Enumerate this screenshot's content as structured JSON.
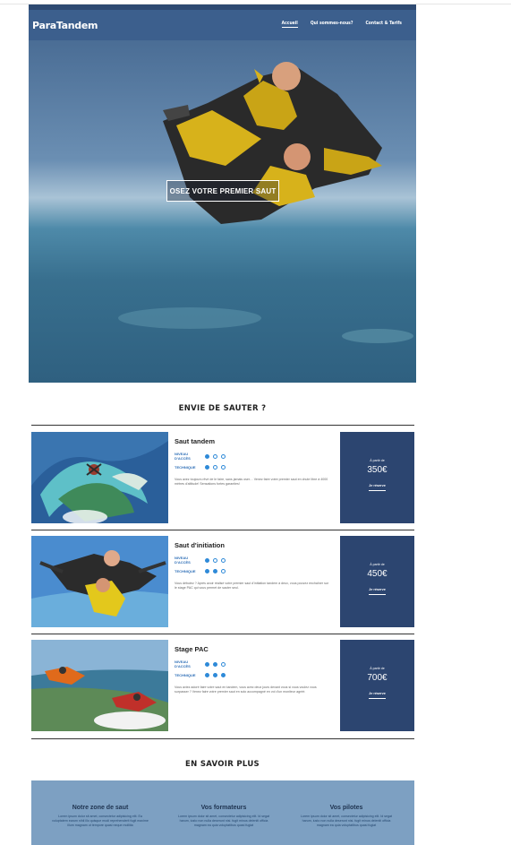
{
  "site": {
    "logo": "ParaTandem"
  },
  "nav": {
    "items": [
      "Accueil",
      "Qui sommes-nous?",
      "Contact & Tarifs"
    ]
  },
  "hero": {
    "cta": "OSEZ VOTRE PREMIER SAUT"
  },
  "section1": {
    "title": "ENVIE DE SAUTER ?"
  },
  "labels": {
    "access": "NIVEAU D'ACCÈS",
    "technique": "TECHNIQUE",
    "from": "À partir de",
    "reserve": "Je réserve"
  },
  "offers": [
    {
      "name": "Saut tandem",
      "access": 1,
      "technique": 1,
      "desc": "Vous avez toujours rêvé de le faire, sans jamais oser… Venez faire votre premier saut en chute libre à 4000 mètres d'altitude! Sensations fortes garanties!",
      "price": "350€"
    },
    {
      "name": "Saut d'initiation",
      "access": 1,
      "technique": 2,
      "desc": "Vous débutez ? Après avoir réalisé votre premier saut d'initiation tandem à deux, vous pouvez enchaîner sur le stage PAC qui vous permet de sauter seul.",
      "price": "450€"
    },
    {
      "name": "Stage PAC",
      "access": 2,
      "technique": 3,
      "desc": "Vous aviez adoré faire votre saut en tandem, vous avez deux jours devant vous si vous voulez vous surpasser ? Venez faire votre premier saut en solo accompagné en vol d'un moniteur agréé.",
      "price": "700€"
    }
  ],
  "section2": {
    "title": "EN SAVOIR PLUS"
  },
  "more": [
    {
      "title": "Notre zone de saut",
      "text": "Lorem ipsum dolor sit amet, consectetur adipisicing elit. Ea voluptatem earum nihil illo quisque modi reprehenderit fugit maxime illum magnam ut tempore quasi neque mollitia"
    },
    {
      "title": "Vos formateurs",
      "text": "Lorem ipsum dolor sit amet, consectetur adipisicing elit. Id segat harum, iusto non nulla deserunt nisi. fugit minus deleniti officia magnam ea quia voluptatibus quasi fugiat"
    },
    {
      "title": "Vos pilotes",
      "text": "Lorem ipsum dolor sit amet, consectetur adipisicing elit. Id segat harum, iusto non nulla deserunt nisi. fugit minus deleniti officia magnam ea quia voluptatibus quasi fugiat"
    }
  ]
}
